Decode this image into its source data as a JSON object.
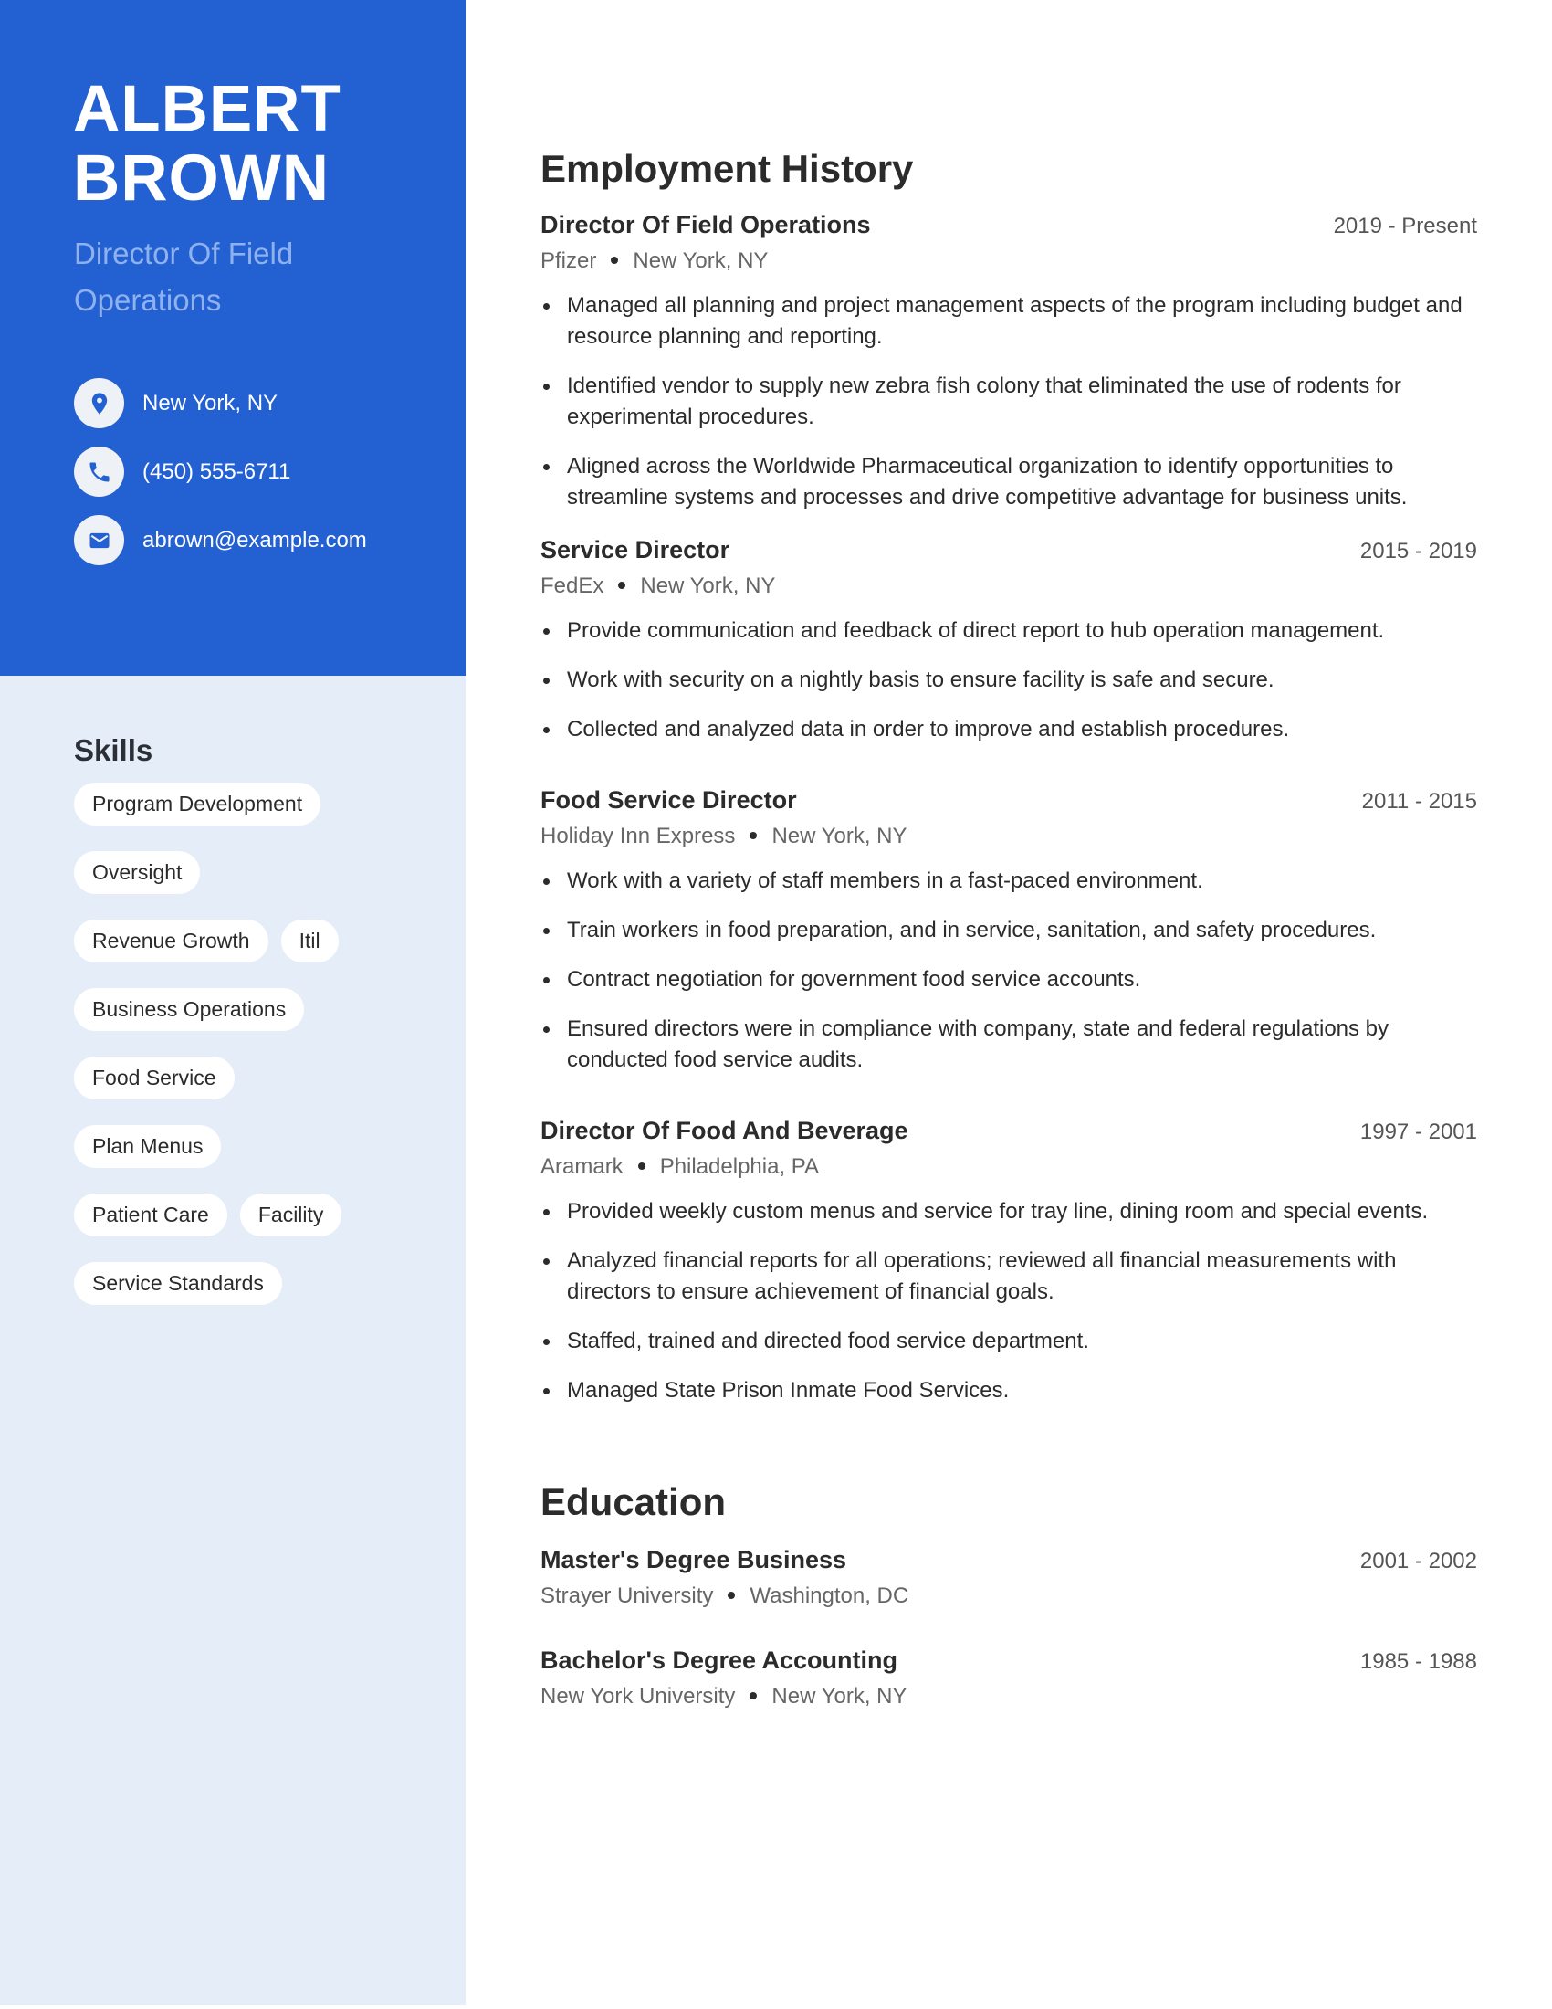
{
  "profile": {
    "first_name": "ALBERT",
    "last_name": "BROWN",
    "title": "Director Of Field Operations"
  },
  "contact": [
    {
      "icon": "location-pin-icon",
      "text": "New York, NY"
    },
    {
      "icon": "phone-icon",
      "text": "(450) 555-6711"
    },
    {
      "icon": "mail-icon",
      "text": "abrown@example.com"
    }
  ],
  "skills": {
    "heading": "Skills",
    "items": [
      "Program Development",
      "Oversight",
      "Revenue Growth",
      "Itil",
      "Business Operations",
      "Food Service",
      "Plan Menus",
      "Patient Care",
      "Facility",
      "Service Standards"
    ]
  },
  "employment": {
    "heading": "Employment History",
    "jobs": [
      {
        "role": "Director Of Field Operations",
        "dates": "2019 - Present",
        "company": "Pfizer",
        "location": "New York, NY",
        "bullets": [
          "Managed all planning and project management aspects of the program including budget and resource planning and reporting.",
          "Identified vendor to supply new zebra fish colony that eliminated the use of rodents for experimental procedures.",
          "Aligned across the Worldwide Pharmaceutical organization to identify opportunities to streamline systems and processes and drive competitive advantage for business units."
        ]
      },
      {
        "role": "Service Director",
        "dates": "2015 - 2019",
        "company": "FedEx",
        "location": "New York, NY",
        "bullets": [
          "Provide communication and feedback of direct report to hub operation management.",
          "Work with security on a nightly basis to ensure facility is safe and secure.",
          "Collected and analyzed data in order to improve and establish procedures."
        ]
      },
      {
        "role": "Food Service Director",
        "dates": "2011 - 2015",
        "company": "Holiday Inn Express",
        "location": "New York, NY",
        "bullets": [
          "Work with a variety of staff members in a fast-paced environment.",
          "Train workers in food preparation, and in service, sanitation, and safety procedures.",
          "Contract negotiation for government food service accounts.",
          "Ensured directors were in compliance with company, state and federal regulations by conducted food service audits."
        ]
      },
      {
        "role": "Director Of Food And Beverage",
        "dates": "1997 - 2001",
        "company": "Aramark",
        "location": "Philadelphia, PA",
        "bullets": [
          "Provided weekly custom menus and service for tray line, dining room and special events.",
          "Analyzed financial reports for all operations; reviewed all financial measurements with directors to ensure achievement of financial goals.",
          "Staffed, trained and directed food service department.",
          "Managed State Prison Inmate Food Services."
        ]
      }
    ]
  },
  "education": {
    "heading": "Education",
    "entries": [
      {
        "degree": "Master's Degree Business",
        "dates": "2001 - 2002",
        "school": "Strayer University",
        "location": "Washington, DC"
      },
      {
        "degree": "Bachelor's Degree Accounting",
        "dates": "1985 - 1988",
        "school": "New York University",
        "location": "New York, NY"
      }
    ]
  },
  "colors": {
    "accent": "#2360d2",
    "sidebar_bg": "#e5edf9",
    "subtitle": "#8fb2ee"
  }
}
